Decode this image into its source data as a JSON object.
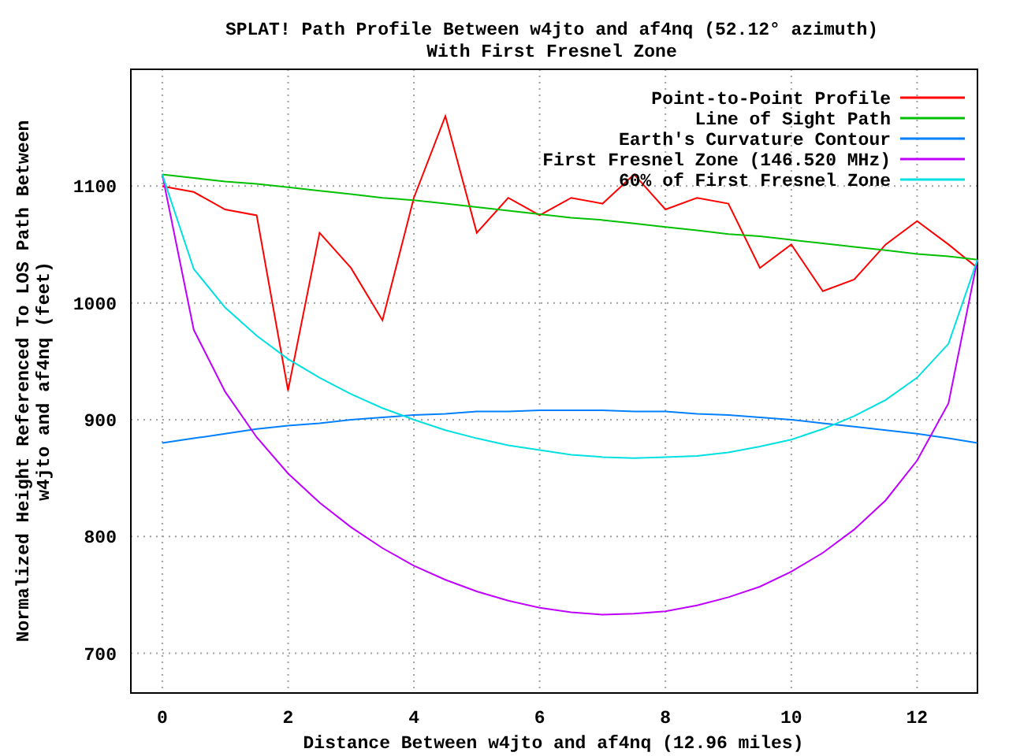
{
  "title_lines": [
    "SPLAT! Path Profile Between w4jto and af4nq (52.12° azimuth)",
    "With First Fresnel Zone"
  ],
  "chart_data": {
    "type": "line",
    "xlabel": "Distance Between w4jto and af4nq (12.96 miles)",
    "ylabel": "Normalized Height Referenced To LOS Path Between\nw4jto and af4nq (feet)",
    "x": [
      0,
      0.5,
      1,
      1.5,
      2,
      2.5,
      3,
      3.5,
      4,
      4.5,
      5,
      5.5,
      6,
      6.5,
      7,
      7.5,
      8,
      8.5,
      9,
      9.5,
      10,
      10.5,
      11,
      11.5,
      12,
      12.5,
      12.96
    ],
    "series": [
      {
        "name": "Point-to-Point Profile",
        "color": "#ff0000",
        "values": [
          1100,
          1095,
          1080,
          1075,
          925,
          1060,
          1030,
          985,
          1090,
          1160,
          1060,
          1090,
          1075,
          1090,
          1085,
          1110,
          1080,
          1090,
          1085,
          1030,
          1050,
          1010,
          1020,
          1050,
          1070,
          1050,
          1030
        ]
      },
      {
        "name": "Line of Sight Path",
        "color": "#00c000",
        "values": [
          1110,
          1107,
          1104,
          1102,
          1099,
          1096,
          1093,
          1090,
          1088,
          1085,
          1082,
          1079,
          1076,
          1073,
          1071,
          1068,
          1065,
          1062,
          1059,
          1057,
          1054,
          1051,
          1048,
          1045,
          1042,
          1040,
          1037
        ]
      },
      {
        "name": "Earth's Curvature Contour",
        "color": "#0080ff",
        "values": [
          880,
          884,
          888,
          892,
          895,
          897,
          900,
          902,
          904,
          905,
          907,
          907,
          908,
          908,
          908,
          907,
          907,
          905,
          904,
          902,
          900,
          897,
          894,
          891,
          888,
          884,
          880
        ]
      },
      {
        "name": "First Fresnel Zone (146.520 MHz)",
        "color": "#c000ff",
        "values": [
          1110,
          977,
          924,
          885,
          854,
          829,
          808,
          790,
          775,
          763,
          753,
          745,
          739,
          735,
          733,
          734,
          736,
          741,
          748,
          757,
          770,
          786,
          806,
          831,
          865,
          914,
          1037
        ]
      },
      {
        "name": "60% of First Fresnel Zone",
        "color": "#00e0e0",
        "values": [
          1110,
          1029,
          996,
          972,
          952,
          936,
          922,
          910,
          900,
          891,
          884,
          878,
          874,
          870,
          868,
          867,
          868,
          869,
          872,
          877,
          883,
          892,
          903,
          917,
          936,
          965,
          1037
        ]
      }
    ],
    "grid": true,
    "legend": true,
    "xlim": [
      -0.5,
      12.96
    ],
    "ylim": [
      666,
      1200
    ],
    "xticks": [
      0,
      2,
      4,
      6,
      8,
      10,
      12
    ],
    "yticks": [
      700,
      800,
      900,
      1000,
      1100
    ]
  }
}
